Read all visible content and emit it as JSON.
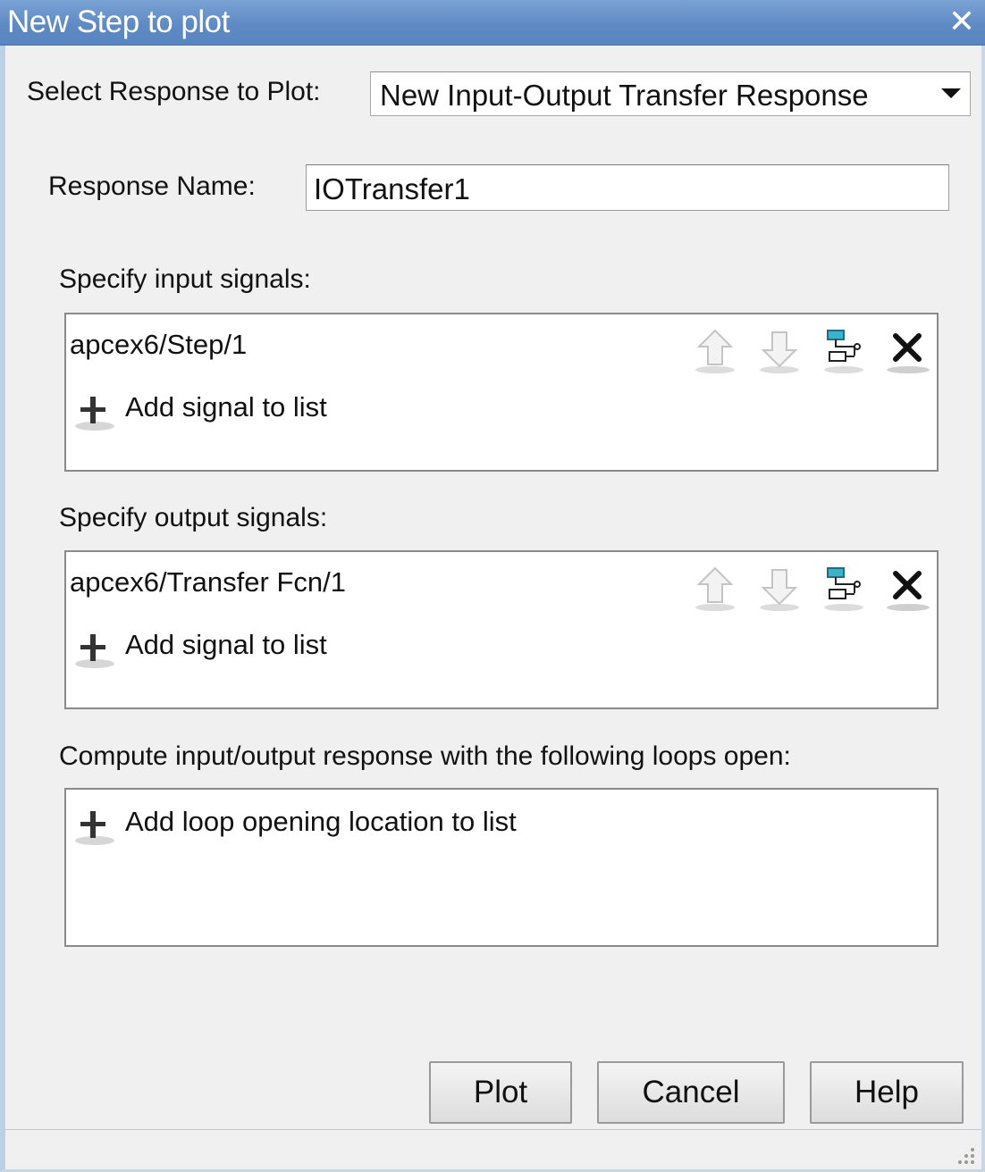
{
  "window": {
    "title": "New Step to plot"
  },
  "response_select": {
    "label": "Select Response to Plot:",
    "value": "New Input-Output Transfer Response"
  },
  "response_name": {
    "label": "Response Name:",
    "value": "IOTransfer1"
  },
  "inputs": {
    "label": "Specify input signals:",
    "signals": [
      "apcex6/Step/1"
    ],
    "add_label": "Add signal to list"
  },
  "outputs": {
    "label": "Specify output signals:",
    "signals": [
      "apcex6/Transfer Fcn/1"
    ],
    "add_label": "Add signal to list"
  },
  "loops": {
    "label": "Compute input/output response with the following loops open:",
    "add_label": "Add loop opening location to list"
  },
  "buttons": {
    "plot": "Plot",
    "cancel": "Cancel",
    "help": "Help"
  },
  "icons": {
    "move_up": "arrow-up-icon",
    "move_down": "arrow-down-icon",
    "select_in_model": "signal-select-icon",
    "delete": "close-x-icon",
    "add": "plus-icon"
  },
  "colors": {
    "titlebar": "#5f8ac4",
    "window_bg": "#f0f0f0"
  }
}
